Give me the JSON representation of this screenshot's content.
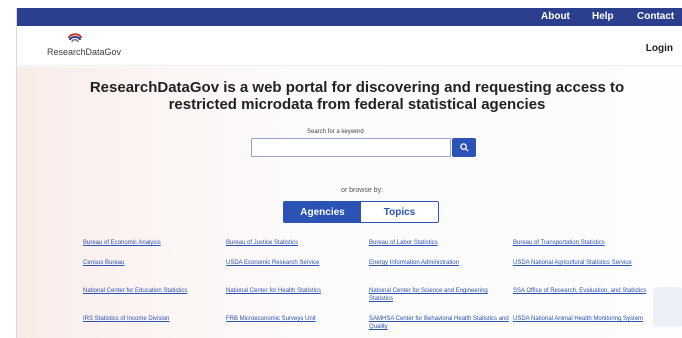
{
  "topnav": {
    "about": "About",
    "help": "Help",
    "contact": "Contact"
  },
  "header": {
    "logo_text": "ResearchDataGov",
    "login": "Login"
  },
  "hero": {
    "headline_line1": "ResearchDataGov is a web portal for discovering and requesting access to",
    "headline_line2": "restricted microdata from federal statistical agencies",
    "search_label": "Search for a keyword",
    "search_value": "",
    "browse_label": "or browse by:"
  },
  "tabs": {
    "agencies": "Agencies",
    "topics": "Topics",
    "active": "agencies"
  },
  "agencies": [
    "Bureau of Economic Analysis",
    "Bureau of Justice Statistics",
    "Bureau of Labor Statistics",
    "Bureau of Transportation Statistics",
    "Census Bureau",
    "USDA Economic Research Service",
    "Energy Information Administration",
    "USDA National Agricultural Statistics Service",
    "National Center for Education Statistics",
    "National Center for Health Statistics",
    "National Center for Science and Engineering Statistics",
    "SSA Office of Research, Evaluation, and Statistics",
    "IRS Statistics of Income Division",
    "FRB Microeconomic Surveys Unit",
    "SAMHSA Center for Behavioral Health Statistics and Quality",
    "USDA National Animal Health Monitoring System"
  ],
  "colors": {
    "topbar": "#2b3f8e",
    "accent": "#2b52b5"
  }
}
